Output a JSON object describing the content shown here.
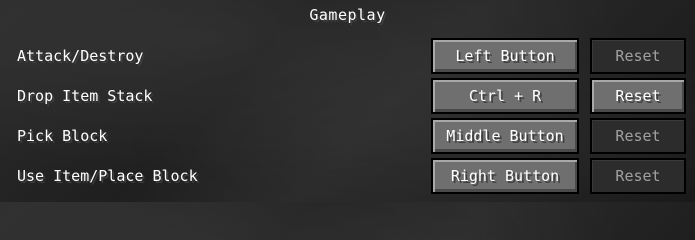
{
  "section": {
    "title": "Gameplay"
  },
  "controls": [
    {
      "action": "Attack/Destroy",
      "key": "Left Button",
      "reset_label": "Reset",
      "reset_enabled": false
    },
    {
      "action": "Drop Item Stack",
      "key": "Ctrl + R",
      "reset_label": "Reset",
      "reset_enabled": true
    },
    {
      "action": "Pick Block",
      "key": "Middle Button",
      "reset_label": "Reset",
      "reset_enabled": false
    },
    {
      "action": "Use Item/Place Block",
      "key": "Right Button",
      "reset_label": "Reset",
      "reset_enabled": false
    }
  ],
  "colors": {
    "button_face": "#6f6f6f",
    "button_disabled_face": "#2c2c2c",
    "text": "#ffffff",
    "text_disabled": "#a0a0a0"
  }
}
